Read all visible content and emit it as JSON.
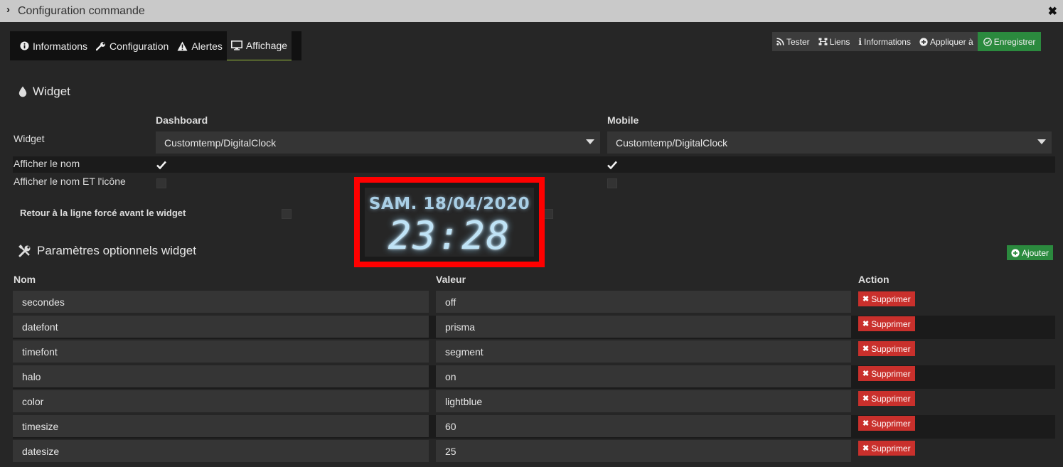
{
  "window": {
    "title": "Configuration commande"
  },
  "tabs": [
    {
      "label": "Informations",
      "icon": "info-circle-icon"
    },
    {
      "label": "Configuration",
      "icon": "wrench-icon"
    },
    {
      "label": "Alertes",
      "icon": "warning-icon"
    },
    {
      "label": "Affichage",
      "icon": "monitor-icon",
      "active": true
    }
  ],
  "actions": {
    "tester": "Tester",
    "liens": "Liens",
    "informations": "Informations",
    "appliquer": "Appliquer à",
    "enregistrer": "Enregistrer"
  },
  "widget_section": {
    "title": "Widget",
    "col_dashboard": "Dashboard",
    "col_mobile": "Mobile",
    "widget_label": "Widget",
    "dashboard_widget": "Customtemp/DigitalClock",
    "mobile_widget": "Customtemp/DigitalClock",
    "show_name_label": "Afficher le nom",
    "show_name_icon_label": "Afficher le nom ET l'icône",
    "line_break_label": "Retour à la ligne forcé avant le widget"
  },
  "clock": {
    "date": "SAM. 18/04/2020",
    "time": "23:28",
    "color": "#add8e6"
  },
  "params_section": {
    "title": "Paramètres optionnels widget",
    "add_label": "Ajouter",
    "col_name": "Nom",
    "col_value": "Valeur",
    "col_action": "Action",
    "delete_label": "Supprimer",
    "rows": [
      {
        "name": "secondes",
        "value": "off"
      },
      {
        "name": "datefont",
        "value": "prisma"
      },
      {
        "name": "timefont",
        "value": "segment"
      },
      {
        "name": "halo",
        "value": "on"
      },
      {
        "name": "color",
        "value": "lightblue"
      },
      {
        "name": "timesize",
        "value": "60"
      },
      {
        "name": "datesize",
        "value": "25"
      }
    ]
  },
  "colors": {
    "accent_green": "#2b8a3e",
    "danger_red": "#c9302c",
    "highlight_red": "#ff0000"
  }
}
